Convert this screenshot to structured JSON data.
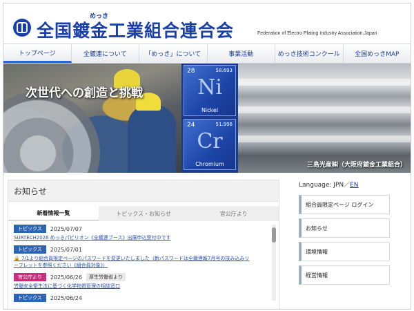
{
  "header": {
    "title": "全国鍍金工業組合連合会",
    "ruby": "めっき",
    "subtitle": "Federation of Electro Plating Industry Association,Japan"
  },
  "nav": {
    "items": [
      {
        "label": "トップページ",
        "active": true
      },
      {
        "label": "全鍍連について"
      },
      {
        "label": "「めっき」について"
      },
      {
        "label": "事業活動"
      },
      {
        "label": "めっき技術コンクール"
      },
      {
        "label": "全国めっきMAP"
      }
    ]
  },
  "hero": {
    "slogan": "次世代への創造と挑戦",
    "elements": [
      {
        "number": "28",
        "mass": "58.693",
        "symbol": "Ni",
        "name": "Nickel"
      },
      {
        "number": "24",
        "mass": "51.996",
        "symbol": "Cr",
        "name": "Chromium"
      }
    ],
    "caption": "三島光産㈱（大阪府鍍金工業組合）"
  },
  "notice": {
    "heading": "お知らせ",
    "tabs": [
      "新着情報一覧",
      "トピックス・お知らせ",
      "官公庁より"
    ],
    "entries": [
      {
        "badge": "トピックス",
        "date": "2025/07/07",
        "text": "SURTECH2026 めっきパビリオン《全鍍連ブース》出展申込受付中です"
      },
      {
        "badge": "トピックス",
        "date": "2025/07/01",
        "text": "🔒 7/1より組合員限定ページのパスワードを変更いたしました（新パスワードは全鍍連報7月号の挟み込みリーフレットを参照ください《組合員対象》）"
      },
      {
        "badge": "官公庁より",
        "date": "2025/06/26",
        "sub": "厚生労働省より",
        "text": "労働安全衛生法に基づく化学物質管理の相談窓口"
      },
      {
        "badge": "トピックス",
        "date": "2025/06/24",
        "text": ""
      }
    ]
  },
  "sidebar": {
    "language_label": "Language: JPN／",
    "language_en": "EN",
    "items": [
      "組合員限定ページ ログイン",
      "お知らせ",
      "環境情報",
      "経営情報"
    ]
  },
  "colors": {
    "brand": "#1a3fa8",
    "topics": "#2c64b8",
    "gov": "#c4307b"
  }
}
